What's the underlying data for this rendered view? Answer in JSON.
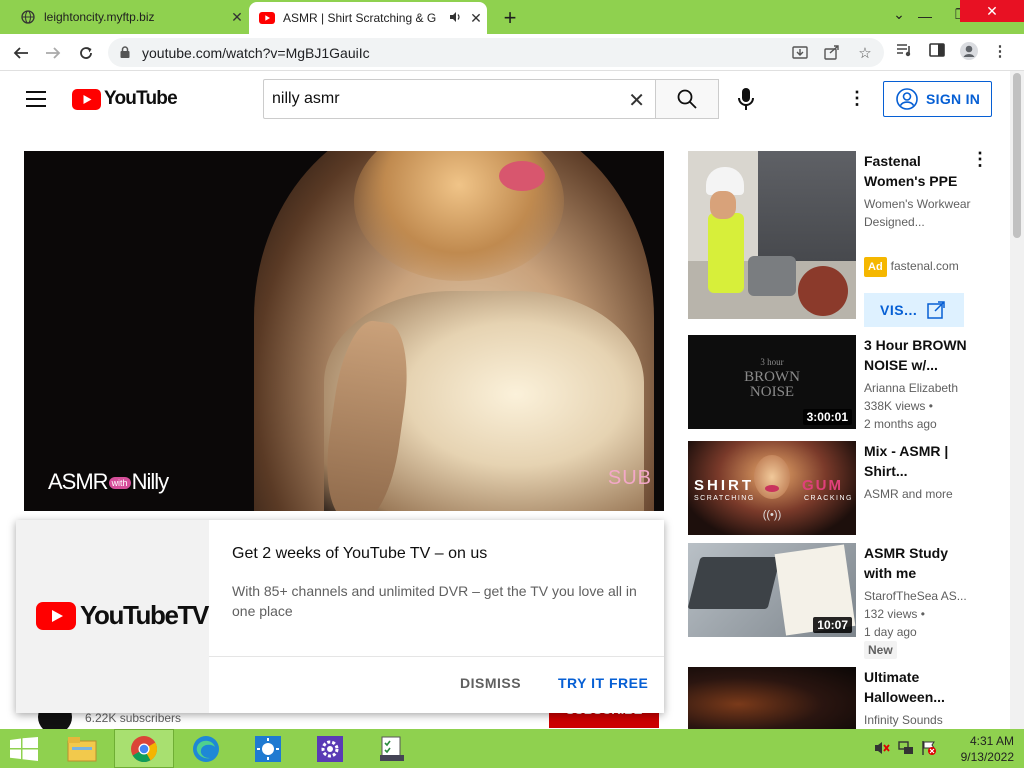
{
  "browser": {
    "tabs": [
      {
        "title": "leightoncity.myftp.biz",
        "favicon": "globe-icon"
      },
      {
        "title": "ASMR | Shirt Scratching & G",
        "favicon": "youtube-icon",
        "audio": "speaker-icon"
      }
    ],
    "url": "youtube.com/watch?v=MgBJ1GauiIc",
    "new_tab": "+",
    "window_controls": {
      "minimize": "⌄",
      "restore": "❐",
      "close": "✕"
    }
  },
  "youtube": {
    "logo_text": "YouTube",
    "search": {
      "value": "nilly asmr",
      "clear": "✕"
    },
    "sign_in": "SIGN IN",
    "colors": {
      "brand_red": "#ff0000",
      "link_blue": "#065fd4"
    }
  },
  "video": {
    "watermark_left": "ASMR",
    "watermark_with": "with",
    "watermark_right": "Nilly",
    "corner_text": "SUB"
  },
  "promo": {
    "logo_text": "YouTubeTV",
    "title": "Get 2 weeks of YouTube TV – on us",
    "description": "With 85+ channels and unlimited DVR – get the TV you love all in one place",
    "dismiss": "DISMISS",
    "try_free": "TRY IT FREE"
  },
  "channel": {
    "subscribers": "6.22K subscribers",
    "subscribe": "SUBSCRIBE"
  },
  "recommendations": [
    {
      "title": "Fastenal Women's PPE",
      "desc": "Women's Workwear Designed...",
      "ad_label": "Ad",
      "domain": "fastenal.com",
      "visit": "VIS..."
    },
    {
      "title": "3 Hour BROWN NOISE w/...",
      "channel": "Arianna Elizabeth",
      "views": "338K views •",
      "age": "2 months ago",
      "duration": "3:00:01",
      "thumb_text_1": "3 hour",
      "thumb_text_2": "BROWN",
      "thumb_text_3": "NOISE"
    },
    {
      "title": "Mix - ASMR | Shirt...",
      "channel": "ASMR and more",
      "thumb_text_1": "SHIRT",
      "thumb_text_2": "GUM",
      "thumb_text_3": "SCRATCHING",
      "thumb_text_4": "CRACKING",
      "thumb_live": "((•))"
    },
    {
      "title": "ASMR Study with me",
      "channel": "StarofTheSea AS...",
      "views": "132 views •",
      "age": "1 day ago",
      "badge": "New",
      "duration": "10:07"
    },
    {
      "title": "Ultimate Halloween...",
      "channel": "Infinity Sounds"
    }
  ],
  "taskbar": {
    "time": "4:31 AM",
    "date": "9/13/2022"
  }
}
